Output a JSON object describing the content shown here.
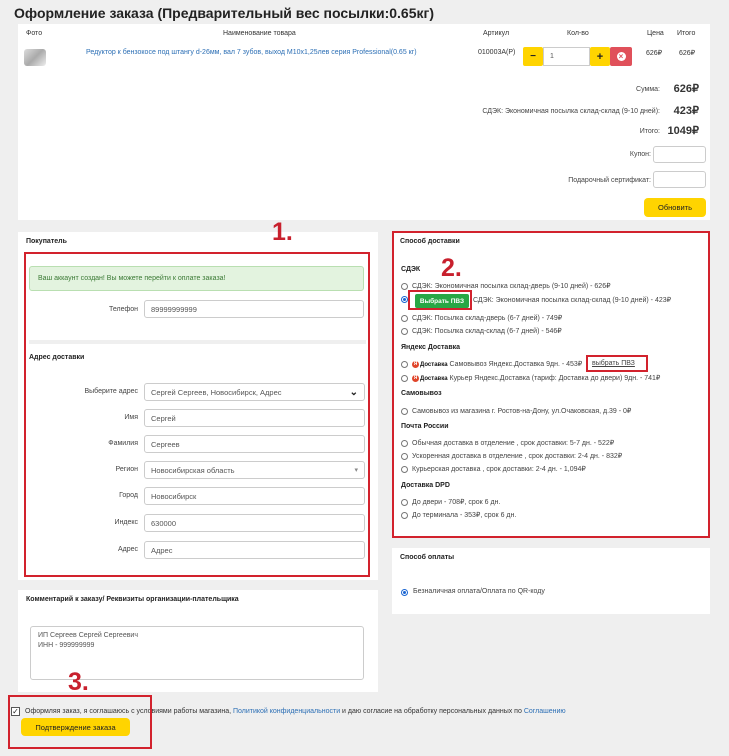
{
  "page_title": "Оформление заказа (Предварительный вес посылки:0.65кг)",
  "cart": {
    "headers": {
      "photo": "Фото",
      "name": "Наименование товара",
      "article": "Артикул",
      "qty": "Кол-во",
      "price": "Цена",
      "total": "Итого"
    },
    "item": {
      "name": "Редуктор к бензокосе под штангу d-26мм, вал 7 зубов, выход М10х1,25лев серия Professional(0.65 кг)",
      "article": "010003А(Р)",
      "qty": "1",
      "price": "626₽",
      "total": "626₽",
      "minus": "−",
      "plus": "+",
      "remove": "×"
    },
    "summary": {
      "sum_label": "Сумма:",
      "sum_value": "626₽",
      "delivery_label": "СДЭК: Экономичная посылка склад-склад (9-10 дней):",
      "delivery_value": "423₽",
      "total_label": "Итого:",
      "total_value": "1049₽",
      "coupon_label": "Купон:",
      "coupon_value": "",
      "cert_label": "Подарочный сертификат:",
      "cert_value": "",
      "update_button": "Обновить"
    }
  },
  "buyer": {
    "title": "Покупатель",
    "alert": "Ваш аккаунт создан! Вы можете перейти к оплате заказа!",
    "phone_label": "Телефон",
    "phone_value": "89999999999",
    "address_title": "Адрес доставки",
    "fields": [
      {
        "label": "Выберите адрес",
        "value": "Сергей Сергеев, Новосибирск, Адрес"
      },
      {
        "label": "Имя",
        "value": "Сергей"
      },
      {
        "label": "Фамилия",
        "value": "Сергеев"
      },
      {
        "label": "Регион",
        "value": "Новосибирская область"
      },
      {
        "label": "Город",
        "value": "Новосибирск"
      },
      {
        "label": "Индекс",
        "value": "630000"
      },
      {
        "label": "Адрес",
        "value": "Адрес"
      }
    ]
  },
  "delivery": {
    "title": "Способ доставки",
    "cdek_title": "СДЭК",
    "cdek": [
      "СДЭК: Экономичная посылка склад-дверь (9-10 дней) - 626₽",
      "СДЭК: Экономичная посылка склад-склад (9-10 дней) - 423₽",
      "СДЭК: Посылка склад-дверь (6-7 дней) - 749₽",
      "СДЭК: Посылка склад-склад (6-7 дней) - 546₽"
    ],
    "choose_pvz_button": "Выбрать ПВЗ",
    "yandex_title": "Яндекс Доставка",
    "yandex_brand": "Доставка",
    "yandex": [
      "Самовывоз Яндекс.Доставка 9дн. - 453₽",
      "Курьер Яндекс.Доставка (тариф: Доставка до двери) 9дн. - 741₽"
    ],
    "yandex_link": "выбрать ПВЗ",
    "self_title": "Самовывоз",
    "self": [
      "Самовывоз из магазина г. Ростов-на-Дону, ул.Очаковская, д.39 - 0₽"
    ],
    "russian_post_title": "Почта России",
    "russian_post": [
      "Обычная доставка в отделение , срок доставки: 5-7 дн. - 522₽",
      "Ускоренная доставка в отделение , срок доставки: 2-4 дн. - 832₽",
      "Курьерская доставка , срок доставки: 2-4 дн. - 1,094₽"
    ],
    "dpd_title": "Доставка DPD",
    "dpd": [
      "До двери - 708₽, срок 6 дн.",
      "До терминала - 353₽, срок 6 дн."
    ]
  },
  "payment": {
    "title": "Способ оплаты",
    "option": "Безналичная оплата/Оплата по QR-коду"
  },
  "comment": {
    "title": "Комментарий к заказу/ Реквизиты организации-плательщика",
    "value": "ИП Сергеев Сергей Сергеевич\nИНН - 999999999"
  },
  "agreement": {
    "text1": "Оформляя заказ, я соглашаюсь с условиями работы магазина, ",
    "link1": "Политикой конфиденциальности",
    "text2": " и даю согласие на обработку персональных данных по ",
    "link2": "Соглашению"
  },
  "confirm_button": "Подтверждение заказа",
  "annotations": [
    "1.",
    "2.",
    "3."
  ],
  "colors": {
    "accent": "#ffd400",
    "annotation": "#d2222d",
    "link": "#2c6fb5",
    "green": "#28a745"
  }
}
